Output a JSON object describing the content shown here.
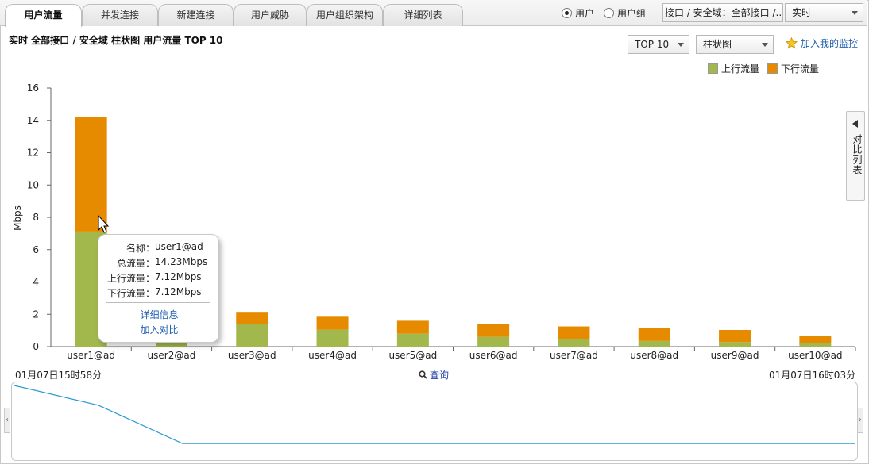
{
  "tabs": [
    {
      "label": "用户流量",
      "active": true
    },
    {
      "label": "并发连接",
      "active": false
    },
    {
      "label": "新建连接",
      "active": false
    },
    {
      "label": "用户威胁",
      "active": false
    },
    {
      "label": "用户组织架构",
      "active": false
    },
    {
      "label": "详细列表",
      "active": false
    }
  ],
  "scope_radio": {
    "user": "用户",
    "group": "用户组",
    "selected": "user"
  },
  "interface_select": "接口 / 安全域：全部接口 /...",
  "time_select": "实时",
  "subtitle": "实时  全部接口 / 安全域  柱状图  用户流量  TOP 10",
  "top_select": "TOP 10",
  "chart_type_select": "柱状图",
  "add_monitor": "加入我的监控",
  "compare_list": "对比列表",
  "colors": {
    "up": "#a2b84c",
    "down": "#e68a00",
    "link": "#1f5fae",
    "overview_line": "#2a9bd6"
  },
  "chart_data": {
    "type": "bar",
    "stacked": true,
    "categories": [
      "user1@ad",
      "user2@ad",
      "user3@ad",
      "user4@ad",
      "user5@ad",
      "user6@ad",
      "user7@ad",
      "user8@ad",
      "user9@ad",
      "user10@ad"
    ],
    "series": [
      {
        "name": "上行流量",
        "values": [
          7.12,
          1.1,
          1.4,
          1.05,
          0.8,
          0.6,
          0.45,
          0.35,
          0.28,
          0.2
        ]
      },
      {
        "name": "下行流量",
        "values": [
          7.11,
          1.0,
          0.75,
          0.8,
          0.8,
          0.8,
          0.8,
          0.8,
          0.75,
          0.45
        ]
      }
    ],
    "ylabel": "Mbps",
    "ylim": [
      0,
      16
    ],
    "yticks": [
      0,
      2,
      4,
      6,
      8,
      10,
      12,
      14,
      16
    ],
    "legend_position": "top-right"
  },
  "tooltip": {
    "name_label": "名称：",
    "name_value": "user1@ad",
    "total_label": "总流量：",
    "total_value": "14.23Mbps",
    "up_label": "上行流量：",
    "up_value": "7.12Mbps",
    "down_label": "下行流量：",
    "down_value": "7.12Mbps",
    "detail_link": "详细信息",
    "compare_link": "加入对比"
  },
  "timeline": {
    "start": "01月07日15时58分",
    "end": "01月07日16时03分",
    "query": "查询",
    "overview_values": [
      14.23,
      10.2,
      2.4,
      2.4,
      2.4,
      2.4,
      2.4,
      2.4,
      2.4,
      2.4,
      2.4
    ]
  }
}
